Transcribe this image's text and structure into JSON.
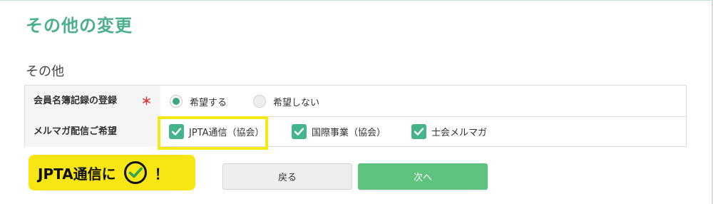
{
  "page": {
    "title": "その他の変更",
    "section_title": "その他"
  },
  "form": {
    "meibo": {
      "label": "会員名簿記録の登録",
      "required_mark": "＊",
      "options": [
        {
          "label": "希望する",
          "selected": true
        },
        {
          "label": "希望しない",
          "selected": false
        }
      ]
    },
    "mailmag": {
      "label": "メルマガ配信ご希望",
      "options": [
        {
          "label": "JPTA通信（協会）",
          "checked": true
        },
        {
          "label": "国際事業（協会）",
          "checked": true
        },
        {
          "label": "士会メルマガ",
          "checked": true
        }
      ]
    }
  },
  "callout": {
    "text": "JPTA通信に",
    "exclaim": "！",
    "icon": "check-circle-icon"
  },
  "buttons": {
    "back_label": "戻る",
    "next_label": "次へ"
  },
  "colors": {
    "accent": "#4caf8e",
    "checkbox": "#46b48a",
    "radio_selected": "#3aa77e",
    "required": "#e53935",
    "highlight": "#f2ea10",
    "callout_bg": "#f7e514",
    "next_button": "#5ec37e",
    "back_button": "#eeeeee"
  }
}
